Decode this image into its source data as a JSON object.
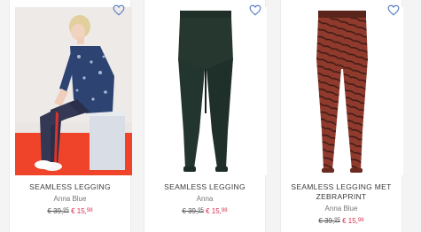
{
  "products": [
    {
      "title": "SEAMLESS LEGGING",
      "brand": "Anna Blue",
      "old_price": "€ 39,",
      "old_cents": "95",
      "new_price": "€ 15,",
      "new_cents": "98",
      "icon": "heart-outline-icon",
      "image": "model-photo"
    },
    {
      "title": "SEAMLESS LEGGING",
      "brand": "Anna",
      "old_price": "€ 39,",
      "old_cents": "95",
      "new_price": "€ 15,",
      "new_cents": "98",
      "icon": "heart-outline-icon",
      "image": "dark-green-legging"
    },
    {
      "title": "SEAMLESS LEGGING MET ZEBRAPRINT",
      "brand": "Anna Blue",
      "old_price": "€ 39,",
      "old_cents": "95",
      "new_price": "€ 15,",
      "new_cents": "98",
      "icon": "heart-outline-icon",
      "image": "zebra-print-legging"
    }
  ],
  "colors": {
    "accent_heart": "#5b7fc4",
    "sale_price": "#d6324f",
    "legging_green": "#23352f",
    "legging_zebra_base": "#8f3a2d",
    "legging_zebra_stripe": "#3f1b15"
  }
}
